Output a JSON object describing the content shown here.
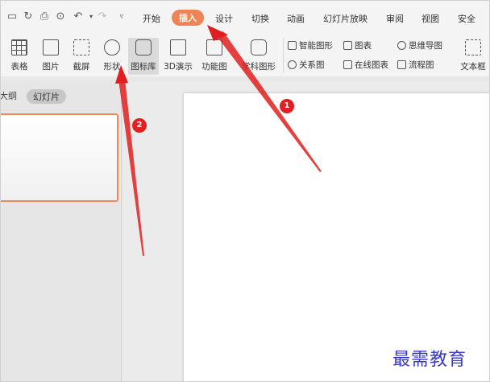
{
  "tabs": [
    {
      "id": "start",
      "label": "开始",
      "active": false
    },
    {
      "id": "insert",
      "label": "插入",
      "active": true
    },
    {
      "id": "design",
      "label": "设计",
      "active": false
    },
    {
      "id": "transition",
      "label": "切换",
      "active": false
    },
    {
      "id": "animation",
      "label": "动画",
      "active": false
    },
    {
      "id": "slideshow",
      "label": "幻灯片放映",
      "active": false
    },
    {
      "id": "review",
      "label": "审阅",
      "active": false
    },
    {
      "id": "view",
      "label": "视图",
      "active": false
    },
    {
      "id": "security",
      "label": "安全",
      "active": false
    }
  ],
  "ribbon": {
    "table": "表格",
    "picture": "图片",
    "screenshot": "截屏",
    "shape": "形状",
    "icon_library": "图标库",
    "three_d": "3D演示",
    "function_chart": "功能图",
    "subject_shape": "学科图形",
    "smart_shape": "智能图形",
    "chart": "图表",
    "relation_chart": "关系图",
    "online_chart": "在线图表",
    "mind_map": "思维导图",
    "flowchart": "流程图",
    "textbox": "文本框"
  },
  "pane_tabs": {
    "outline": "大纲",
    "slides": "幻灯片"
  },
  "annotations": {
    "badge1": "1",
    "badge2": "2",
    "arrow_color": "#e02020"
  },
  "watermark": "最需教育",
  "colors": {
    "accent": "#ee8456",
    "selection_border": "#ef8a57"
  }
}
